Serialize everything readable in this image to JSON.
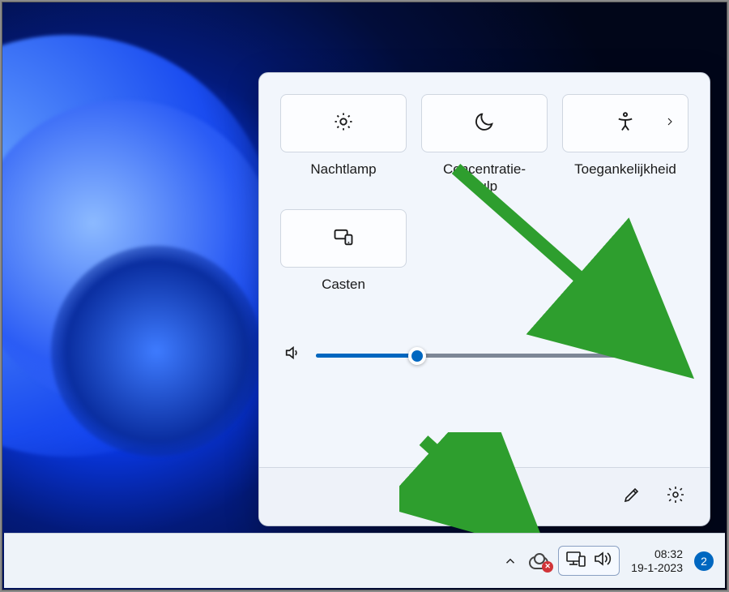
{
  "quick_settings": {
    "tiles": [
      {
        "id": "nightlight",
        "label": "Nachtlamp",
        "icon": "brightness-icon",
        "has_chevron": false
      },
      {
        "id": "focus-assist",
        "label": "Concentratie-\nhulp",
        "icon": "moon-icon",
        "has_chevron": false
      },
      {
        "id": "accessibility",
        "label": "Toegankelijkheid",
        "icon": "accessibility-icon",
        "has_chevron": true
      },
      {
        "id": "cast",
        "label": "Casten",
        "icon": "cast-icon",
        "has_chevron": false
      }
    ],
    "volume": {
      "percent": 30
    },
    "footer": {
      "edit": "edit",
      "settings": "settings"
    }
  },
  "taskbar": {
    "overflow": "chevron-up",
    "cloud_status": "error",
    "systray_selected": {
      "network": "ethernet-disconnected",
      "volume": "volume-on"
    },
    "clock": {
      "time": "08:32",
      "date": "19-1-2023"
    },
    "notification_count": "2"
  },
  "annotations": {
    "arrow1_target": "volume-more-chevron",
    "arrow2_target": "systray-button",
    "color": "#2e9e2e"
  }
}
